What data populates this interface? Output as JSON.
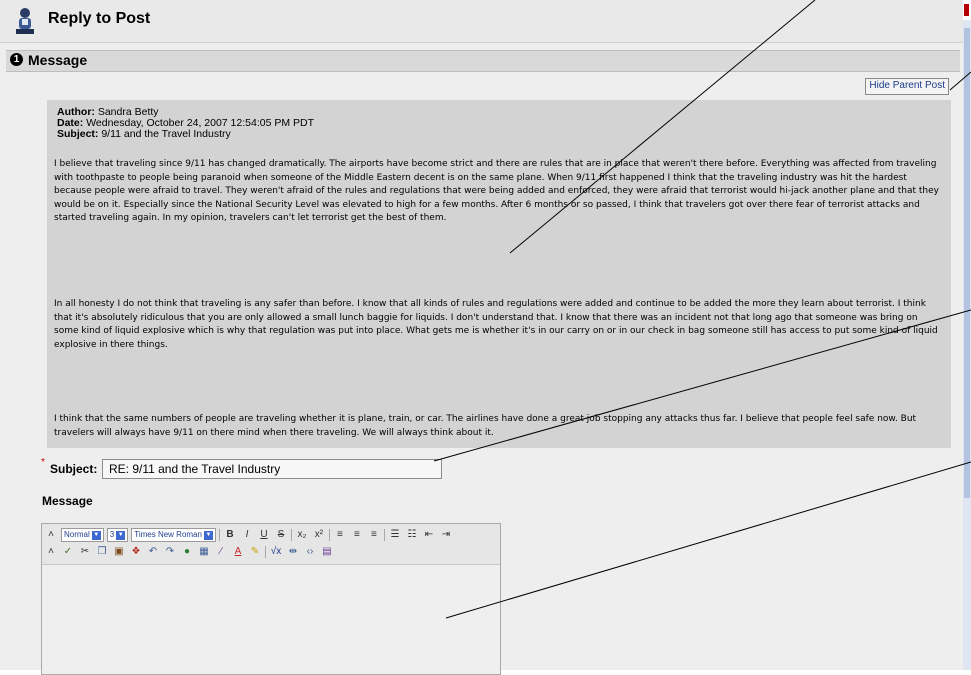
{
  "header": {
    "title": "Reply to Post",
    "icon": "user-posting-icon"
  },
  "section": {
    "number": "1",
    "label": "Message"
  },
  "hide_parent_button": "Hide Parent Post",
  "parent_post": {
    "author_label": "Author:",
    "author": "Sandra Betty",
    "date_label": "Date:",
    "date": "Wednesday, October 24, 2007 12:54:05 PM PDT",
    "subject_label": "Subject:",
    "subject": "9/11 and the Travel Industry",
    "paragraphs": [
      "I believe that traveling since 9/11 has changed dramatically. The airports have become strict and there are rules that are in place that weren't there before. Everything was affected from traveling with toothpaste to people being paranoid when someone of the Middle Eastern decent is on the same plane. When 9/11 first happened I think that the traveling industry was hit the hardest because people were afraid to travel. They weren't afraid of the rules and regulations that were being added and enforced, they were afraid that terrorist would hi-jack another plane and that they would be on it. Especially since the National Security Level was elevated to high for a few months. After 6 months or so passed, I think that travelers got over there fear of terrorist attacks and started traveling again. In my opinion, travelers can't let terrorist get the best of them.",
      "In all honesty I do not think that traveling is any safer than before. I know that all kinds of rules and regulations were added and continue to be added the more they learn about terrorist. I think that it's absolutely ridiculous that you are only allowed a small lunch baggie for liquids. I don't understand that. I know that there was an incident not that long ago that someone was bring on some kind of liquid explosive which is why that regulation was put into place. What gets me is whether it's in our carry on or in our check in bag someone still has access to put some kind of liquid explosive in there things.",
      "I think that the same numbers of people are traveling whether it is plane, train, or car. The airlines have done a great job stopping any attacks thus far. I believe that people feel safe now. But travelers will always have 9/11 on there mind when there traveling. We will always think about it."
    ]
  },
  "form": {
    "required_marker": "*",
    "subject_label": "Subject:",
    "subject_value": "RE: 9/11 and the Travel Industry",
    "message_label": "Message"
  },
  "editor": {
    "format_select": "Normal",
    "size_select": "3",
    "font_select": "Times New Roman"
  },
  "colors": {
    "panel_bg": "#d3d3d3",
    "page_bg": "#eeeeee",
    "required": "#cc0000"
  }
}
